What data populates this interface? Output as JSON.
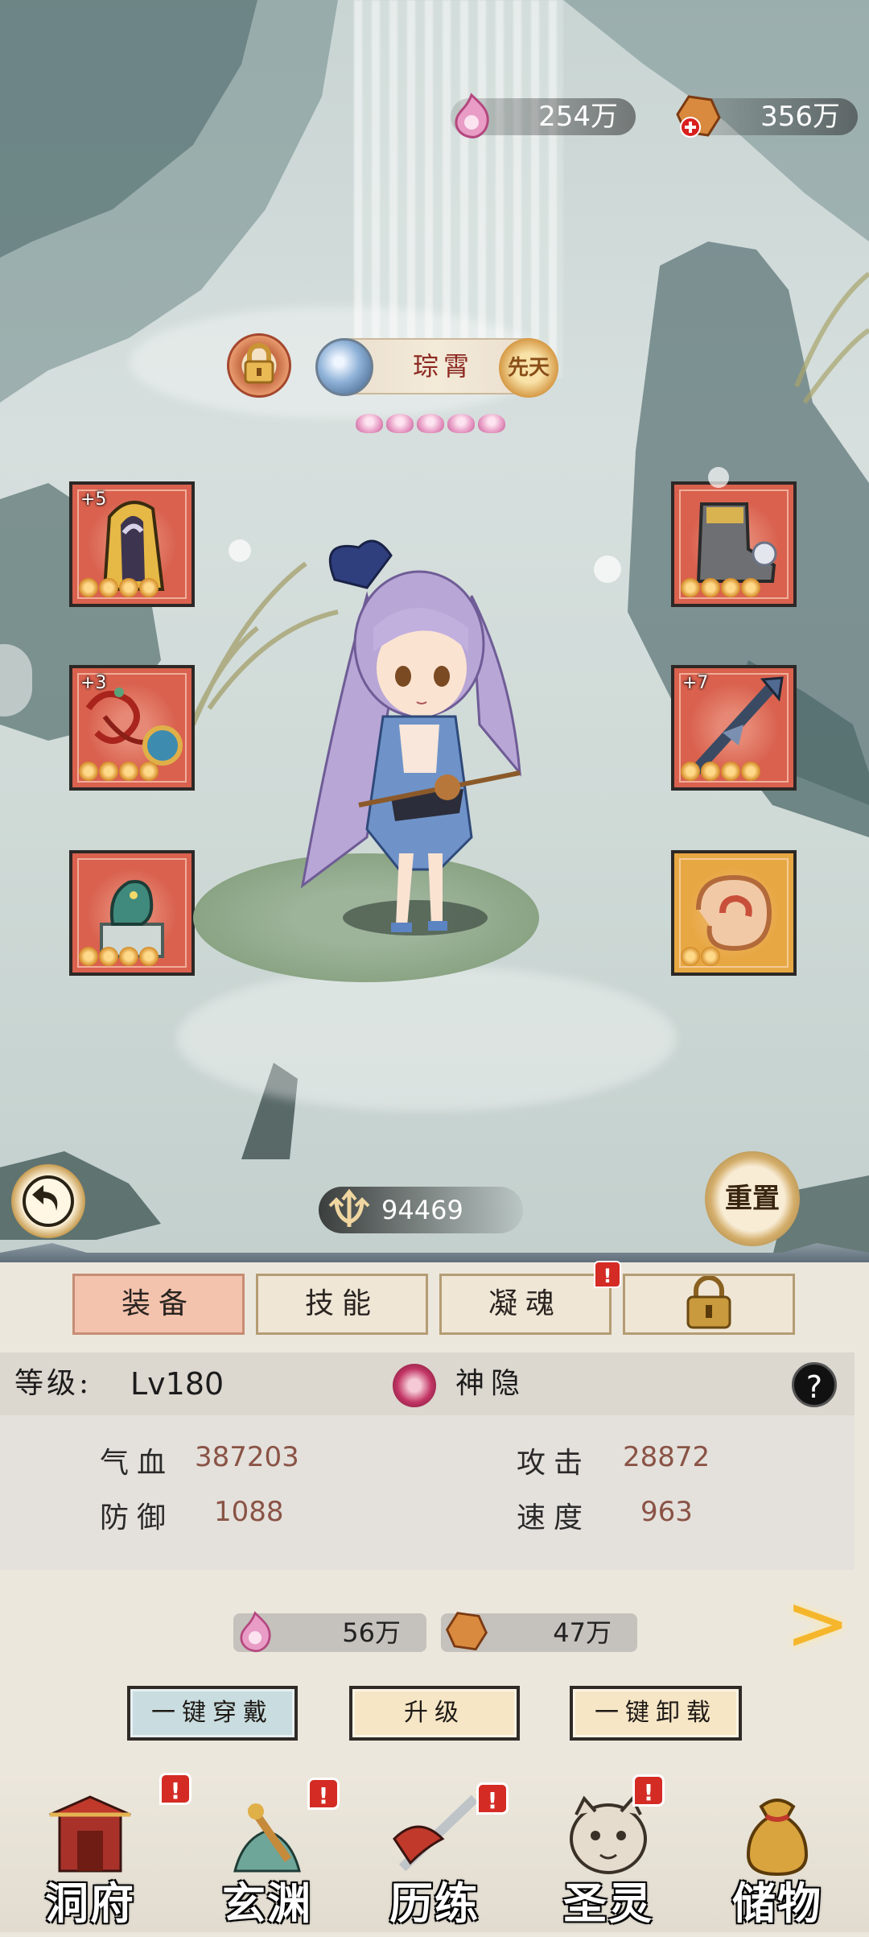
{
  "currency": {
    "spirit_value": "254万",
    "crystal_value": "356万"
  },
  "character": {
    "name": "琮霄",
    "badge": "先天",
    "star_count": 5,
    "combat_power": "94469"
  },
  "equipment": {
    "left": [
      {
        "slot": "hood",
        "plus": "+5"
      },
      {
        "slot": "necklace",
        "plus": "+3"
      },
      {
        "slot": "seal",
        "plus": ""
      }
    ],
    "right": [
      {
        "slot": "boots",
        "plus": ""
      },
      {
        "slot": "spear",
        "plus": "+7"
      },
      {
        "slot": "jade",
        "plus": ""
      }
    ]
  },
  "buttons": {
    "reset": "重置"
  },
  "tabs": [
    {
      "label": "装备",
      "active": true
    },
    {
      "label": "技能",
      "active": false
    },
    {
      "label": "凝魂",
      "active": false,
      "badge": "!"
    },
    {
      "label": "",
      "active": false,
      "icon": "lock-icon"
    }
  ],
  "info": {
    "level_label": "等级:",
    "level_value": "Lv180",
    "class_name": "神隐",
    "help": "?"
  },
  "stats": {
    "hp_label": "气血",
    "hp_value": "387203",
    "attack_label": "攻击",
    "attack_value": "28872",
    "defense_label": "防御",
    "defense_value": "1088",
    "speed_label": "速度",
    "speed_value": "963"
  },
  "costs": {
    "spirit_cost": "56万",
    "crystal_cost": "47万"
  },
  "actions": {
    "equip_all": "一键穿戴",
    "upgrade": "升级",
    "unequip_all": "一键卸载"
  },
  "nav": [
    {
      "label": "洞府",
      "badge": "!"
    },
    {
      "label": "玄渊",
      "badge": "!"
    },
    {
      "label": "历练",
      "badge": "!"
    },
    {
      "label": "圣灵",
      "badge": "!"
    },
    {
      "label": "储物",
      "badge": ""
    }
  ],
  "colors": {
    "slot_red": "#d9614e",
    "slot_gold": "#e7a844",
    "tab_active": "#f3c3ad",
    "badge_red": "#d42b24",
    "stat_value": "#8a5346"
  }
}
